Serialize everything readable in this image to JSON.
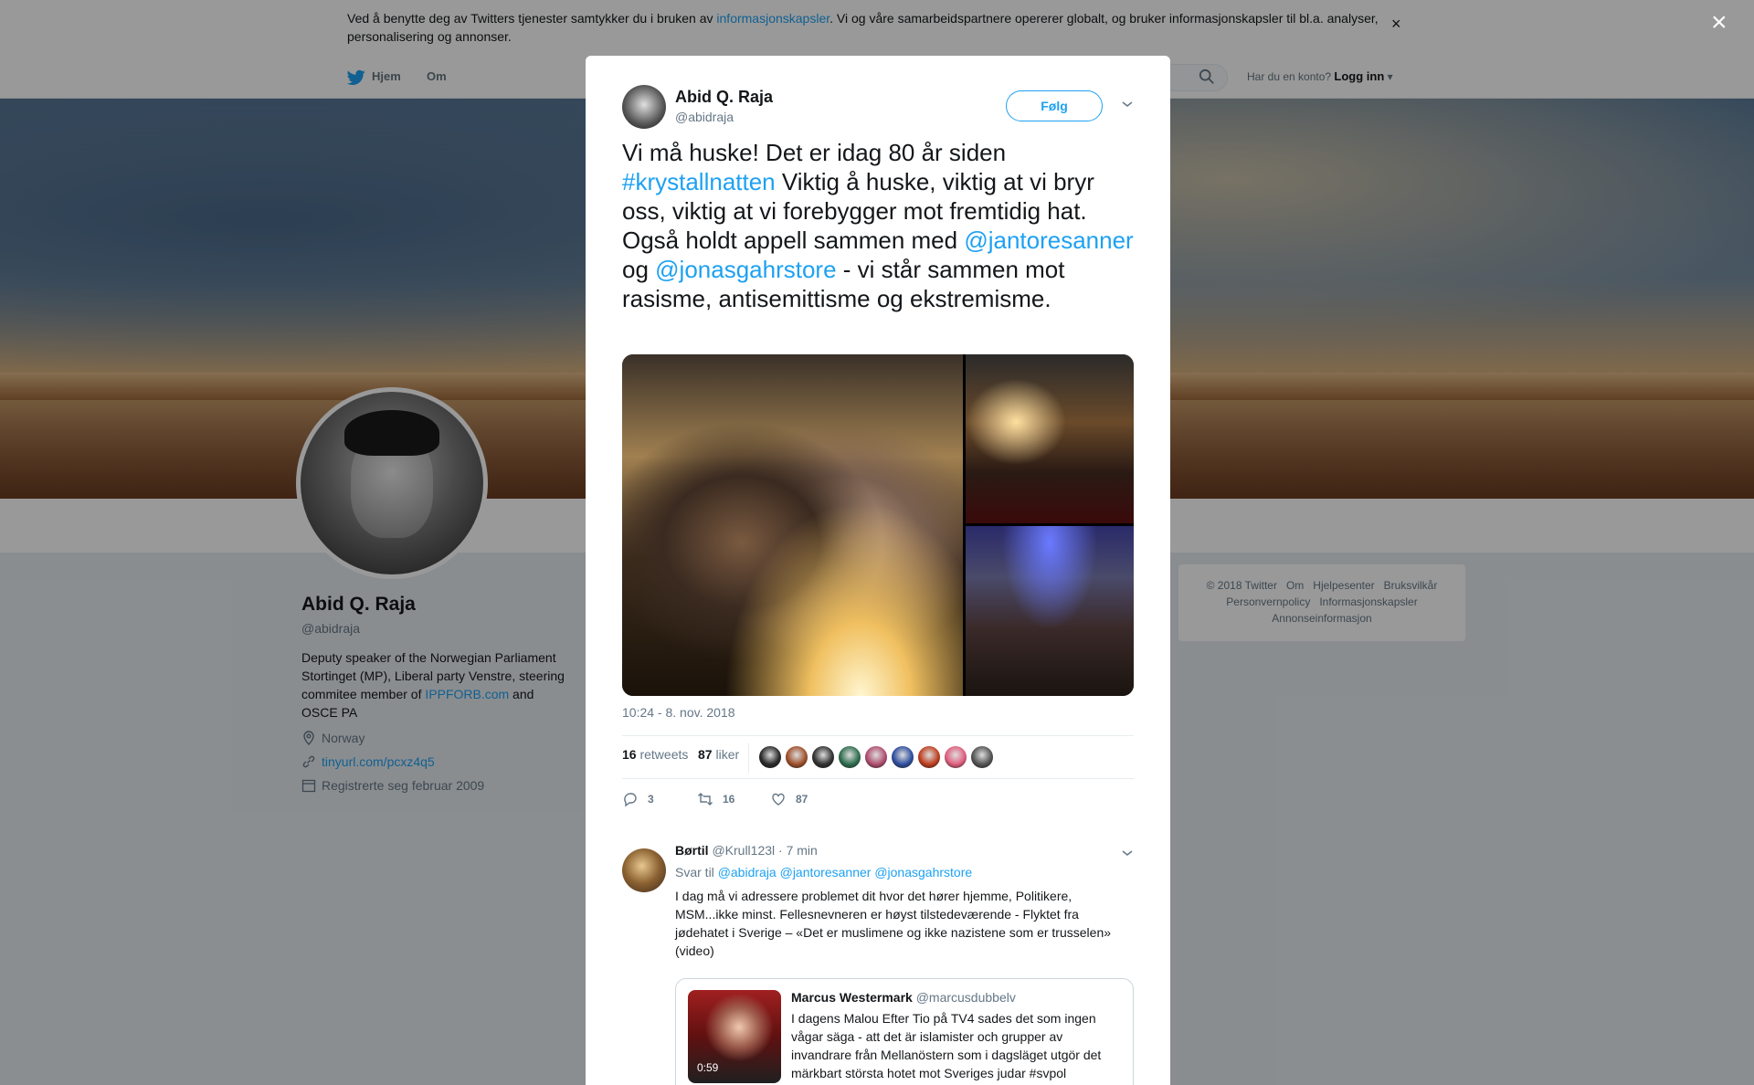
{
  "cookie": {
    "text_before": "Ved å benytte deg av Twitters tjenester samtykker du i bruken av ",
    "link": "informasjonskapsler",
    "text_after": ". Vi og våre samarbeidspartnere opererer globalt, og bruker informasjonskapsler til bl.a. analyser, personalisering og annonser.",
    "close": "×"
  },
  "topnav": {
    "home": "Hjem",
    "about": "Om",
    "account_prompt": "Har du en konto?",
    "login": "Logg inn"
  },
  "profile": {
    "name": "Abid Q. Raja",
    "handle": "@abidraja",
    "bio_text": "Deputy speaker of the Norwegian Parliament Stortinget (MP), Liberal party Venstre, steering commitee member of ",
    "bio_link": "IPPFORB.com",
    "bio_end": " and OSCE PA",
    "location": "Norway",
    "url": "tinyurl.com/pcxz4q5",
    "joined": "Registrerte seg februar 2009"
  },
  "footer": {
    "items": [
      "© 2018 Twitter",
      "Om",
      "Hjelpesenter",
      "Bruksvilkår",
      "Personvernpolicy",
      "Informasjonskapsler",
      "Annonseinformasjon"
    ]
  },
  "overlay_close": "×",
  "tweet": {
    "author_name": "Abid Q. Raja",
    "author_handle": "@abidraja",
    "follow": "Følg",
    "text_1": "Vi må huske! Det er idag 80 år siden ",
    "hashtag": "#krystallnatten",
    "text_2": " Viktig å huske, viktig at vi bryr oss, viktig at vi forebygger mot fremtidig hat. Også holdt appell sammen med ",
    "mention_1": "@jantoresanner",
    "text_3": " og ",
    "mention_2": "@jonasgahrstore",
    "text_4": " - vi står sammen mot rasisme, antisemittisme og ekstremisme.",
    "timestamp": "10:24 - 8. nov. 2018",
    "retweets_count": "16",
    "retweets_label": "retweets",
    "likes_count": "87",
    "likes_label": "liker",
    "liker_avatar_colors": [
      "#2a2a2a",
      "#a0522d",
      "#333333",
      "#2f6f4f",
      "#b05070",
      "#3050a0",
      "#c04020",
      "#e06080",
      "#555555"
    ],
    "actions": {
      "replies": "3",
      "retweets": "16",
      "likes": "87"
    }
  },
  "reply": {
    "name": "Børtil",
    "handle": "@Krull123l",
    "time": "· 7 min",
    "svar_til": "Svar til",
    "to_1": "@abidraja",
    "to_2": "@jantoresanner",
    "to_3": "@jonasgahrstore",
    "text": "I dag må vi adressere problemet dit hvor det hører hjemme, Politikere, MSM...ikke minst. Fellesnevneren er høyst tilstedeværende - Flyktet fra jødehatet i Sverige – «Det er muslimene og ikke nazistene som er trusselen» (video)",
    "quote": {
      "name": "Marcus Westermark",
      "handle": "@marcusdubbelv",
      "text": "I dagens Malou Efter Tio på TV4 sades det som ingen vågar säga - att det är islamister och grupper av invandrare från Mellanöstern som i dagsläget utgör det märkbart största hotet mot Sveriges judar #svpol",
      "duration": "0:59"
    }
  }
}
